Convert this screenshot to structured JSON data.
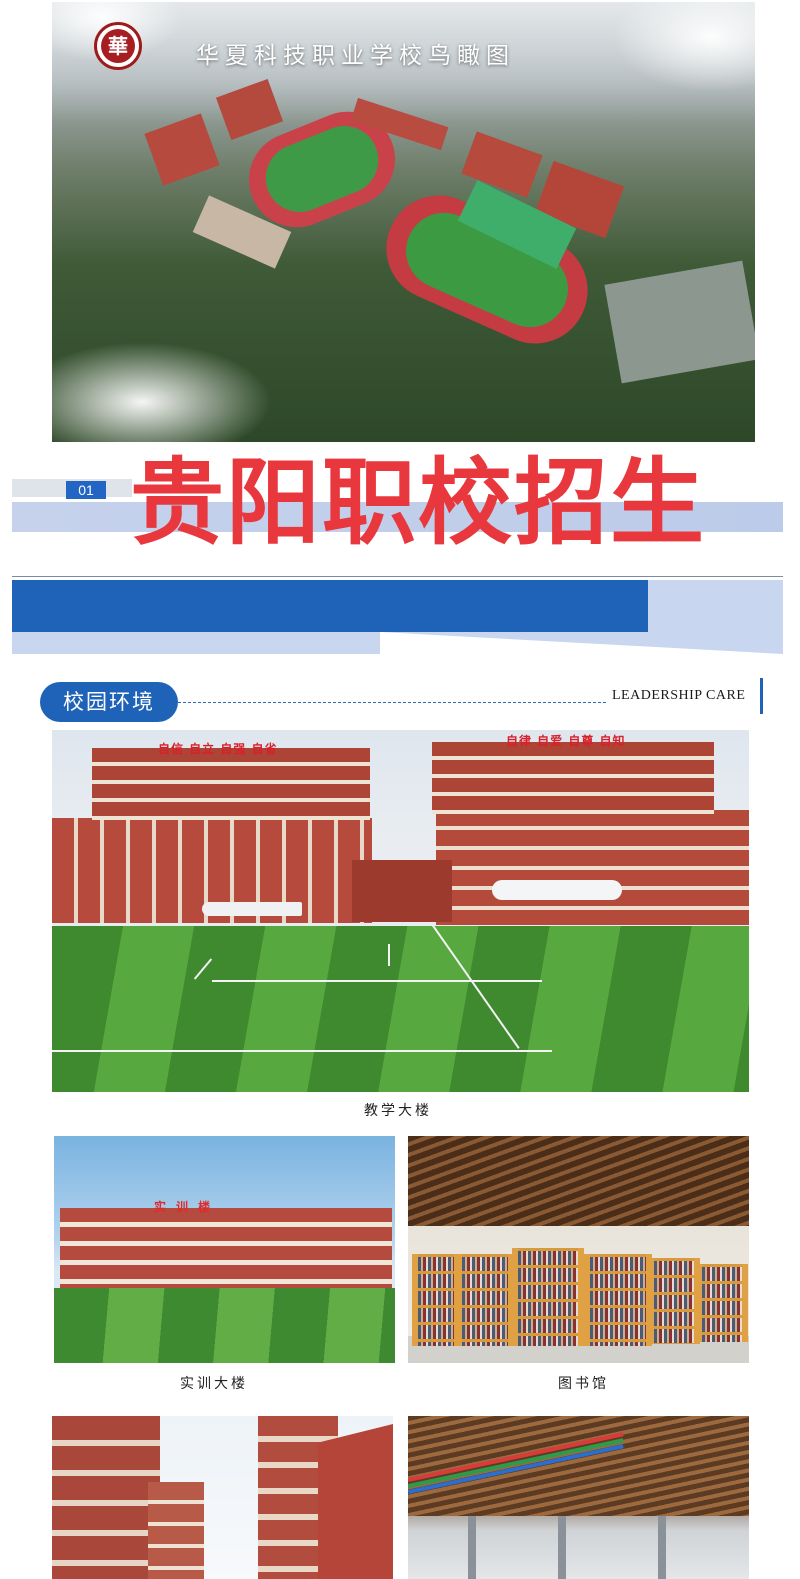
{
  "aerial": {
    "title": "华夏科技职业学校鸟瞰图",
    "emblem_char": "華"
  },
  "banner": {
    "number": "01",
    "title": "贵阳职校招生"
  },
  "section": {
    "heading": "校园环境",
    "subtitle": "LEADERSHIP CARE"
  },
  "main_photo": {
    "slogan_left": "自信 自立 自强 自省",
    "slogan_right": "自律 自爱 自尊 自知",
    "caption": "教学大楼"
  },
  "photos": [
    {
      "caption": "实训大楼",
      "sign": "实训楼"
    },
    {
      "caption": "图书馆"
    }
  ],
  "colors": {
    "brand_blue": "#1f63b9",
    "title_red": "#e8383e",
    "light_blue": "#c9d6ef"
  }
}
